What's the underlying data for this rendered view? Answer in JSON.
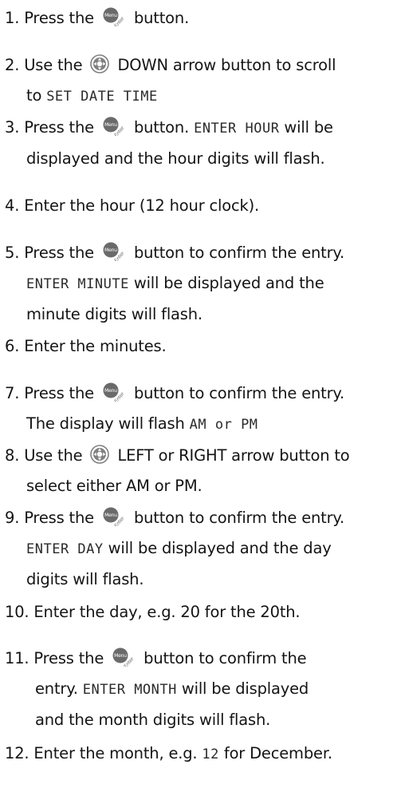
{
  "steps": [
    {
      "n": "1.",
      "lines": [
        [
          "Press the ",
          {
            "icon": "menu-enter"
          },
          " button."
        ]
      ]
    },
    {
      "n": "2.",
      "lines": [
        [
          "Use the ",
          {
            "icon": "nav-pad"
          },
          " DOWN arrow button to scroll"
        ],
        [
          "to ",
          {
            "lcd": "SET DATE TIME"
          }
        ]
      ]
    },
    {
      "n": "3.",
      "lines": [
        [
          "Press the ",
          {
            "icon": "menu-enter"
          },
          " button. ",
          {
            "lcd": "ENTER HOUR"
          },
          " will be"
        ],
        [
          "displayed and the hour digits will flash."
        ]
      ]
    },
    {
      "n": "4.",
      "lines": [
        [
          "Enter the hour (12 hour clock)."
        ]
      ]
    },
    {
      "n": "5.",
      "lines": [
        [
          "Press the ",
          {
            "icon": "menu-enter"
          },
          " button to confirm the entry."
        ],
        [
          {
            "lcd": "ENTER MINUTE"
          },
          " will be displayed and the"
        ],
        [
          "minute digits will flash."
        ]
      ]
    },
    {
      "n": "6.",
      "lines": [
        [
          "Enter the minutes."
        ]
      ]
    },
    {
      "n": "7.",
      "lines": [
        [
          "Press the ",
          {
            "icon": "menu-enter"
          },
          " button to confirm the entry."
        ],
        [
          "The display will flash ",
          {
            "lcd": "AM or PM"
          }
        ]
      ]
    },
    {
      "n": "8.",
      "lines": [
        [
          "Use the ",
          {
            "icon": "nav-pad"
          },
          " LEFT or RIGHT arrow button to"
        ],
        [
          "select either AM or PM."
        ]
      ]
    },
    {
      "n": "9.",
      "lines": [
        [
          "Press the ",
          {
            "icon": "menu-enter"
          },
          " button to confirm the entry."
        ],
        [
          {
            "lcd": "ENTER DAY"
          },
          " will be displayed and the day"
        ],
        [
          "digits will flash."
        ]
      ]
    },
    {
      "n": "10.",
      "lines": [
        [
          "Enter the day, e.g. 20 for the 20th."
        ]
      ]
    },
    {
      "n": "11.",
      "lines": [
        [
          "Press the ",
          {
            "icon": "menu-enter"
          },
          " button to confirm the"
        ],
        [
          "entry. ",
          {
            "lcd": "ENTER MONTH"
          },
          " will be displayed"
        ],
        [
          "and the month digits will flash."
        ]
      ]
    },
    {
      "n": "12.",
      "lines": [
        [
          "Enter the month, e.g. ",
          {
            "lcd": "12"
          },
          " for December."
        ]
      ]
    }
  ],
  "icons": {
    "menu-enter": {
      "top": "Menu",
      "bottom": "Enter",
      "color": "#6a6a6a"
    },
    "nav-pad": {
      "color": "#808080"
    }
  }
}
